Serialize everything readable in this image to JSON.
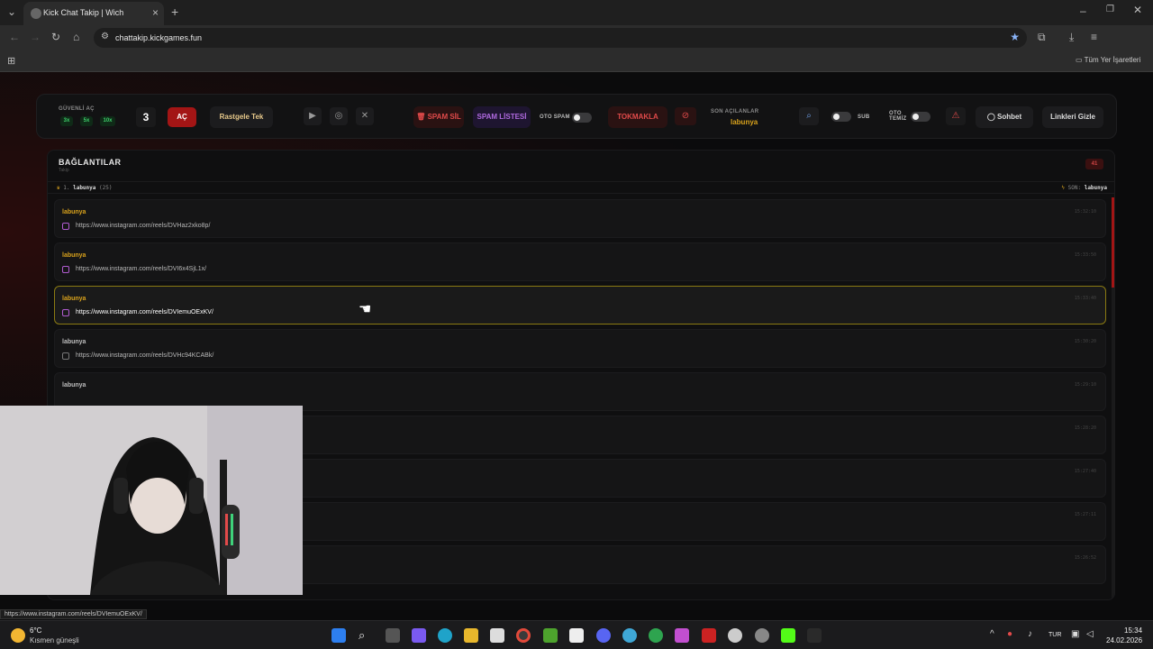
{
  "browser": {
    "tab_title": "Kick Chat Takip | Wich",
    "url": "chattakip.kickgames.fun",
    "bookmarks_all": "Tüm Yer İşaretleri"
  },
  "topbar": {
    "safe_open_label": "GÜVENLİ AÇ",
    "multipliers": [
      "3x",
      "5x",
      "10x"
    ],
    "count": "3",
    "open_button": "AÇ",
    "random_button": "Rastgele Tek",
    "spam_delete": "SPAM SİL",
    "spam_list": "SPAM LİSTESİ",
    "auto_spam": "OTO SPAM",
    "hammer": "TOKMAKLA",
    "recent_label": "SON AÇILANLAR",
    "recent_user": "labunya",
    "sub_label": "SUB",
    "auto_clean": "OTO\nTEMİZ",
    "chat_button": "Sohbet",
    "hide_links_button": "Linkleri Gizle"
  },
  "panel": {
    "title": "BAĞLANTILAR",
    "subtitle": "Takip",
    "count": "41",
    "stat_rank": "1.",
    "stat_user": "labunya",
    "stat_count": "(25)",
    "last_label": "SON:",
    "last_user": "labunya"
  },
  "rows": [
    {
      "user": "labunya",
      "url": "https://www.instagram.com/reels/DVHaz2xko8p/",
      "time": "15:32:10"
    },
    {
      "user": "labunya",
      "url": "https://www.instagram.com/reels/DVI6x4SjL1x/",
      "time": "15:33:50"
    },
    {
      "user": "labunya",
      "url": "https://www.instagram.com/reels/DVIemuOExKV/",
      "time": "15:33:40"
    },
    {
      "user": "labunya",
      "url": "https://www.instagram.com/reels/DVHc94KCABk/",
      "time": "15:30:20"
    },
    {
      "user": "labunya",
      "url": "",
      "time": "15:29:10"
    },
    {
      "user": "",
      "url": "",
      "time": "15:28:20"
    },
    {
      "user": "",
      "url": "",
      "time": "15:27:40"
    },
    {
      "user": "",
      "url": "",
      "time": "15:27:11"
    },
    {
      "user": "",
      "url": "",
      "time": "15:26:52"
    }
  ],
  "status_url": "https://www.instagram.com/reels/DVIemuOExKV/",
  "taskbar": {
    "temp": "6°C",
    "weather": "Kısmen güneşli",
    "lang": "TUR",
    "time": "15:34",
    "date": "24.02.2026"
  },
  "colors": {
    "accent_red": "#a31515",
    "username_gold": "#d9a21c",
    "active_border": "#8a7a12"
  }
}
